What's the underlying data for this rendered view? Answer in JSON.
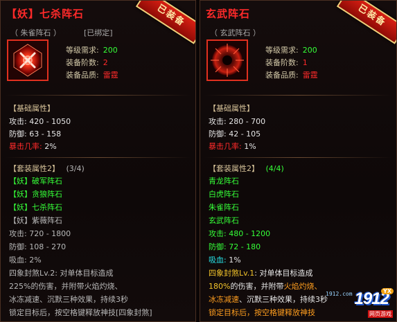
{
  "left": {
    "title_prefix": "【妖】",
    "title_name": "七杀阵石",
    "badge": "已装备",
    "subline_kind": "（ 朱雀阵石 ）",
    "subline_bound": "[已绑定]",
    "info": [
      {
        "label": "等级需求:",
        "value": "200"
      },
      {
        "label": "装备阶数:",
        "value": "2"
      },
      {
        "label": "装备品质:",
        "value": "雷霆"
      }
    ],
    "base_head": "【基础属性】",
    "base": [
      {
        "label": "攻击:",
        "value": "420 - 1050"
      },
      {
        "label": "防御:",
        "value": "63 - 158"
      },
      {
        "label": "暴击几率:",
        "value": "2%"
      }
    ],
    "set_head": "【套装属性2】",
    "set_count": "(3/4)",
    "set_items": [
      "【妖】破军阵石",
      "【妖】贪狼阵石",
      "【妖】七杀阵石",
      "【妖】紫薇阵石"
    ],
    "set_stats": [
      {
        "label": "攻击:",
        "value": "720 - 1800"
      },
      {
        "label": "防御:",
        "value": "108 - 270"
      },
      {
        "label": "吸血:",
        "value": "2%"
      }
    ],
    "skill_lines": [
      "四象封煞Lv.2: 对单体目标造成",
      "225%的伤害，并附带火焰灼烧、",
      "冰冻减速、沉默三种效果，持续3秒",
      "锁定目标后，按空格键释放神技[四象封煞]"
    ]
  },
  "right": {
    "title_name": "玄武阵石",
    "badge": "已装备",
    "subline_kind": "（ 玄武阵石 ）",
    "info": [
      {
        "label": "等级需求:",
        "value": "200"
      },
      {
        "label": "装备阶数:",
        "value": "1"
      },
      {
        "label": "装备品质:",
        "value": "雷霆"
      }
    ],
    "base_head": "【基础属性】",
    "base": [
      {
        "label": "攻击:",
        "value": "280 - 700"
      },
      {
        "label": "防御:",
        "value": "42 - 105"
      },
      {
        "label": "暴击几率:",
        "value": "1%"
      }
    ],
    "set_head": "【套装属性2】",
    "set_count": "(4/4)",
    "set_items": [
      "青龙阵石",
      "白虎阵石",
      "朱雀阵石",
      "玄武阵石"
    ],
    "set_stats": [
      {
        "label": "攻击:",
        "value": "480 - 1200"
      },
      {
        "label": "防御:",
        "value": "72 - 180"
      },
      {
        "label": "吸血:",
        "value": "1%"
      }
    ],
    "skill_line1_a": "四象封煞Lv.1",
    "skill_line1_b": ": 对单体目标造成",
    "skill_line2_a": "180%",
    "skill_line2_b": "的伤害，并附带",
    "skill_line2_c": "火焰灼烧、",
    "skill_line3_a": "冰冻减速",
    "skill_line3_b": "、沉默三种效果，",
    "skill_line3_c": "持续3秒",
    "skill_line4_a": "锁定目标后，按空格键释放",
    "skill_line4_b": "神技"
  },
  "logo": {
    "small": "1912.com",
    "number": "1912",
    "badge": "YX",
    "sub": "网页游戏"
  },
  "colors": {
    "title_red": "#ff2a2a",
    "lime": "#35ff38",
    "gold": "#f3c42b",
    "cyan": "#27e4e9",
    "orange": "#ff9e1f"
  }
}
